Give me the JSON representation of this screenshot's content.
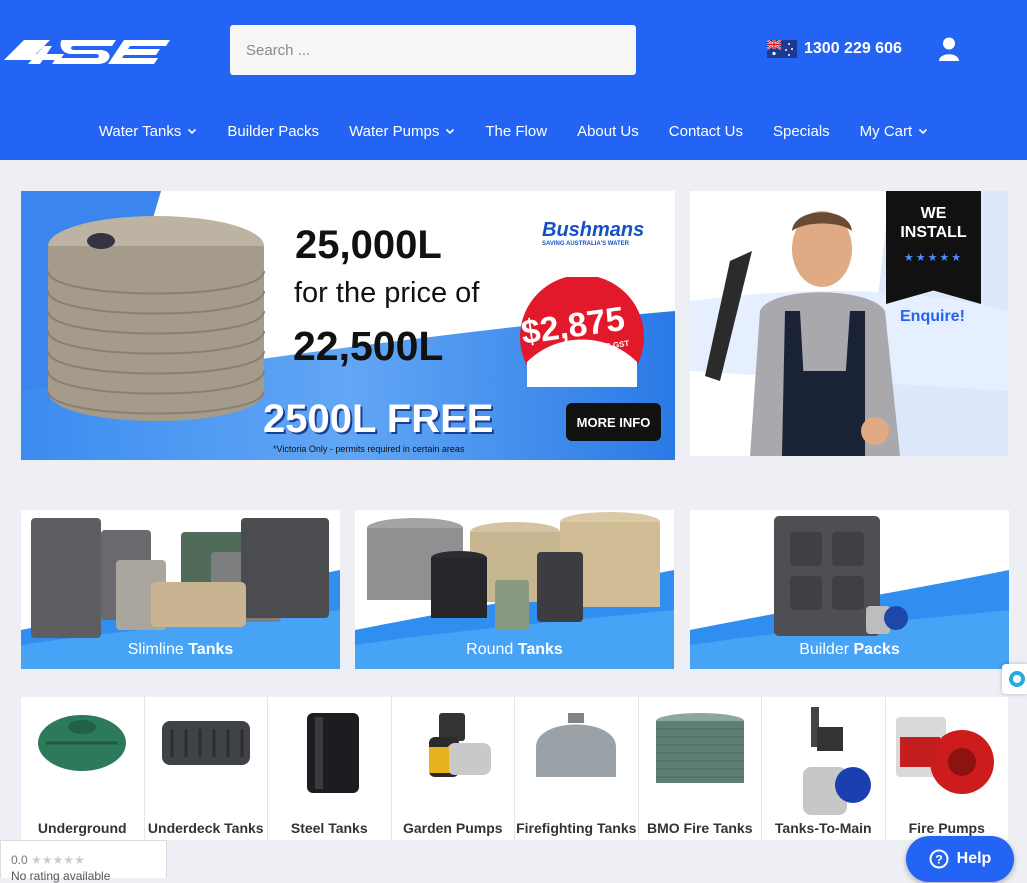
{
  "header": {
    "search_placeholder": "Search ...",
    "phone": "1300 229 606",
    "nav": [
      {
        "label": "Water Tanks",
        "has_menu": true
      },
      {
        "label": "Builder Packs",
        "has_menu": false
      },
      {
        "label": "Water Pumps",
        "has_menu": true
      },
      {
        "label": "The Flow",
        "has_menu": false
      },
      {
        "label": "About Us",
        "has_menu": false
      },
      {
        "label": "Contact Us",
        "has_menu": false
      },
      {
        "label": "Specials",
        "has_menu": false
      },
      {
        "label": "My Cart",
        "has_menu": true
      }
    ]
  },
  "promo": {
    "headline1": "25,000L",
    "headline2": "for the price of",
    "headline3": "22,500L",
    "brand": "Bushmans",
    "brand_tag": "SAVING AUSTRALIA'S WATER",
    "price": "$2,875",
    "price_note": "INC GST",
    "free": "2500L FREE",
    "disclaimer": "*Victoria Only - permits required in certain areas",
    "cta": "MORE INFO"
  },
  "install": {
    "badge_line1": "WE",
    "badge_line2": "INSTALL",
    "stars": "★★★★★",
    "enquire": "Enquire!"
  },
  "categories": [
    {
      "word1": "Slimline",
      "word2": "Tanks"
    },
    {
      "word1": "Round",
      "word2": "Tanks"
    },
    {
      "word1": "Builder",
      "word2": "Packs"
    }
  ],
  "products": [
    {
      "label": "Underground"
    },
    {
      "label": "Underdeck Tanks"
    },
    {
      "label": "Steel Tanks"
    },
    {
      "label": "Garden Pumps"
    },
    {
      "label": "Firefighting Tanks"
    },
    {
      "label": "BMO Fire Tanks"
    },
    {
      "label": "Tanks-To-Main"
    },
    {
      "label": "Fire Pumps"
    }
  ],
  "rating": {
    "score": "0.0",
    "stars": "★★★★★",
    "text": "No rating available"
  },
  "help": {
    "label": "Help"
  },
  "colors": {
    "brand_blue": "#2464f5",
    "price_red": "#e2182b"
  }
}
